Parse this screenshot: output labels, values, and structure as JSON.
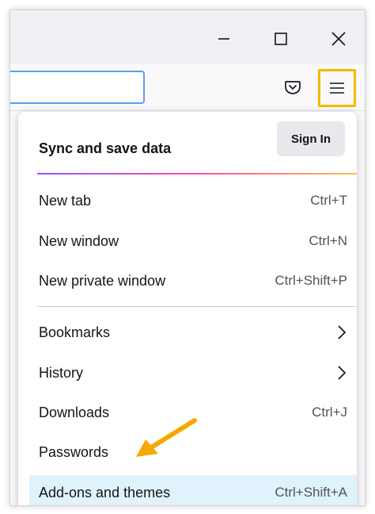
{
  "window": {
    "minimize_label": "Minimize",
    "maximize_label": "Maximize",
    "close_label": "Close"
  },
  "toolbar": {
    "url_value": "",
    "pocket_icon": "pocket-icon",
    "menu_icon": "hamburger-menu-icon"
  },
  "menu": {
    "sync_title": "Sync and save data",
    "sign_in_label": "Sign In",
    "items": [
      {
        "label": "New tab",
        "shortcut": "Ctrl+T"
      },
      {
        "label": "New window",
        "shortcut": "Ctrl+N"
      },
      {
        "label": "New private window",
        "shortcut": "Ctrl+Shift+P"
      },
      {
        "label": "Bookmarks",
        "shortcut": ""
      },
      {
        "label": "History",
        "shortcut": ""
      },
      {
        "label": "Downloads",
        "shortcut": "Ctrl+J"
      },
      {
        "label": "Passwords",
        "shortcut": ""
      },
      {
        "label": "Add-ons and themes",
        "shortcut": "Ctrl+Shift+A"
      }
    ]
  },
  "colors": {
    "highlight_border": "#f5b800",
    "arrow": "#f5a800",
    "hover_bg": "#e0f2fb",
    "url_border": "#5b9fe9"
  }
}
